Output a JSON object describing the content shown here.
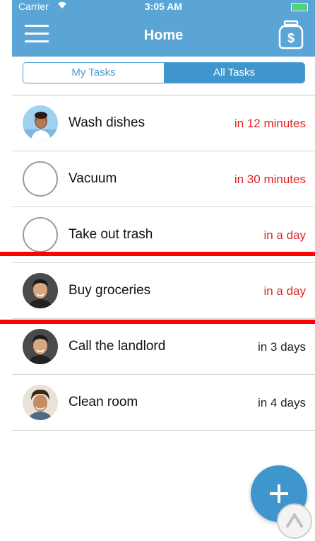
{
  "status_bar": {
    "carrier": "Carrier",
    "time": "3:05 AM"
  },
  "header": {
    "title": "Home"
  },
  "tabs": [
    {
      "label": "My Tasks",
      "selected": false
    },
    {
      "label": "All Tasks",
      "selected": true
    }
  ],
  "tasks": [
    {
      "name": "Wash dishes",
      "due": "in 12 minutes",
      "assignee_avatar": "woman-photo-avatar",
      "due_color": "#e02424"
    },
    {
      "name": "Vacuum",
      "due": "in 30 minutes",
      "assignee_avatar": "empty-circle-avatar",
      "due_color": "#e02424"
    },
    {
      "name": "Take out trash",
      "due": "in a day",
      "assignee_avatar": "empty-circle-avatar",
      "due_color": "#e02424"
    },
    {
      "name": "Buy groceries",
      "due": "in a day",
      "assignee_avatar": "man-photo-avatar",
      "due_color": "#e02424"
    },
    {
      "name": "Call the landlord",
      "due": "in 3 days",
      "assignee_avatar": "man-photo-avatar",
      "due_color": "#222222"
    },
    {
      "name": "Clean room",
      "due": "in 4 days",
      "assignee_avatar": "curly-hair-man-photo-avatar",
      "due_color": "#222222"
    }
  ],
  "colors": {
    "header": "#5aa5d6",
    "accent": "#3f96cc",
    "overdue": "#e02424",
    "highlight_line": "#ff0000"
  },
  "icons": {
    "menu": "hamburger-menu-icon",
    "jar": "money-jar-icon",
    "fab": "plus-icon",
    "scroll_up": "chevron-up-icon"
  }
}
